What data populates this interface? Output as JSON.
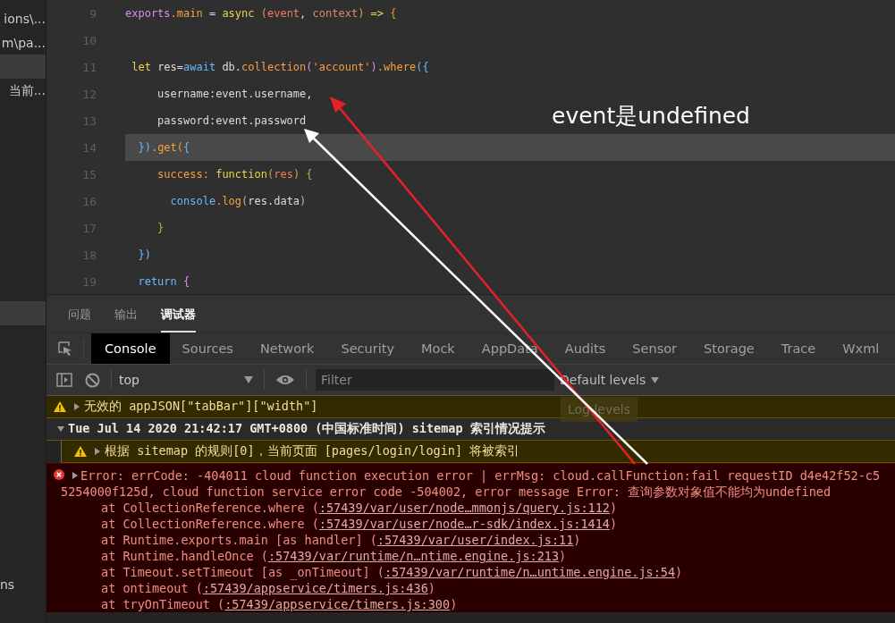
{
  "sidebar": {
    "upper": [
      {
        "label": "ions\\...",
        "selected": false
      },
      {
        "label": "m\\pa...",
        "selected": false
      },
      {
        "selected": true
      },
      {
        "label": "当前...",
        "selected": false
      }
    ],
    "lower": [
      {
        "selected": true
      }
    ],
    "footer": [
      {
        "label": "ns",
        "selected": false
      }
    ]
  },
  "editor": {
    "lines": [
      {
        "number": "9",
        "current": false,
        "tokens": [
          {
            "t": "exports",
            "kind": "module"
          },
          {
            "t": ".main",
            "kind": "prop"
          },
          {
            "t": " = ",
            "kind": "plain"
          },
          {
            "t": "async",
            "kind": "keyword"
          },
          {
            "t": " (",
            "kind": "paren"
          },
          {
            "t": "event",
            "kind": "param"
          },
          {
            "t": ", ",
            "kind": "plain"
          },
          {
            "t": "context",
            "kind": "param2"
          },
          {
            "t": ")",
            "kind": "paren"
          },
          {
            "t": " => ",
            "kind": "keyword"
          },
          {
            "t": "{",
            "kind": "paren"
          }
        ]
      },
      {
        "number": "10",
        "current": false
      },
      {
        "number": "11",
        "current": false,
        "tokens": [
          {
            "t": " let",
            "kind": "keyword"
          },
          {
            "t": " res=",
            "kind": "plain"
          },
          {
            "t": "await",
            "kind": "blue"
          },
          {
            "t": " db.",
            "kind": "plain"
          },
          {
            "t": "collection",
            "kind": "prop"
          },
          {
            "t": "(",
            "kind": "module"
          },
          {
            "t": "'account'",
            "kind": "prop"
          },
          {
            "t": ")",
            "kind": "module"
          },
          {
            "t": ".where",
            "kind": "prop"
          },
          {
            "t": "({",
            "kind": "blue"
          }
        ]
      },
      {
        "number": "12",
        "current": false,
        "tokens": [
          {
            "t": "     username:event.username,",
            "kind": "plain"
          }
        ]
      },
      {
        "number": "13",
        "current": false,
        "tokens": [
          {
            "t": "     password:event.password",
            "kind": "plain"
          }
        ]
      },
      {
        "number": "14",
        "current": true,
        "tokens": [
          {
            "t": "  })",
            "kind": "blue"
          },
          {
            "t": ".get",
            "kind": "prop"
          },
          {
            "t": "(",
            "kind": "paren"
          },
          {
            "t": "{",
            "kind": "blue"
          }
        ]
      },
      {
        "number": "15",
        "current": false,
        "tokens": [
          {
            "t": "     success: ",
            "kind": "prop"
          },
          {
            "t": "function",
            "kind": "keyword"
          },
          {
            "t": "(",
            "kind": "paren"
          },
          {
            "t": "res",
            "kind": "param"
          },
          {
            "t": ") ",
            "kind": "paren"
          },
          {
            "t": "{",
            "kind": "green"
          }
        ]
      },
      {
        "number": "16",
        "current": false,
        "tokens": [
          {
            "t": "       console",
            "kind": "blue"
          },
          {
            "t": ".log",
            "kind": "prop"
          },
          {
            "t": "(",
            "kind": "module"
          },
          {
            "t": "res.data",
            "kind": "plain"
          },
          {
            "t": ")",
            "kind": "module"
          }
        ]
      },
      {
        "number": "17",
        "current": false,
        "tokens": [
          {
            "t": "     }",
            "kind": "green"
          }
        ]
      },
      {
        "number": "18",
        "current": false,
        "tokens": [
          {
            "t": "  })",
            "kind": "blue"
          }
        ]
      },
      {
        "number": "19",
        "current": false,
        "tokens": [
          {
            "t": "  return ",
            "kind": "blue"
          },
          {
            "t": "{",
            "kind": "module"
          }
        ]
      }
    ]
  },
  "annotation": {
    "text": "event是undefined"
  },
  "panel_tabs": [
    {
      "label": "问题",
      "selected": false
    },
    {
      "label": "输出",
      "selected": false
    },
    {
      "label": "调试器",
      "selected": true
    }
  ],
  "devtools_tabs": [
    {
      "label": "Console",
      "selected": true
    },
    {
      "label": "Sources",
      "selected": false
    },
    {
      "label": "Network",
      "selected": false
    },
    {
      "label": "Security",
      "selected": false
    },
    {
      "label": "Mock",
      "selected": false
    },
    {
      "label": "AppData",
      "selected": false
    },
    {
      "label": "Audits",
      "selected": false
    },
    {
      "label": "Sensor",
      "selected": false
    },
    {
      "label": "Storage",
      "selected": false
    },
    {
      "label": "Trace",
      "selected": false
    },
    {
      "label": "Wxml",
      "selected": false
    }
  ],
  "toolbar": {
    "context": "top",
    "filter": {
      "placeholder": "Filter"
    },
    "levels": "Default levels",
    "tooltip": "Log levels"
  },
  "console": [
    {
      "kind": "warning",
      "expanded": false,
      "text": "无效的 appJSON[\"tabBar\"][\"width\"]"
    },
    {
      "kind": "group",
      "expanded": true,
      "text": "Tue Jul 14 2020 21:42:17 GMT+0800 (中国标准时间) sitemap 索引情况提示",
      "children": [
        {
          "kind": "warning",
          "expanded": false,
          "text": "根据 sitemap 的规则[0]，当前页面 [pages/login/login] 将被索引"
        }
      ]
    },
    {
      "kind": "error",
      "expanded": false,
      "lines": [
        "Error: errCode: -404011 cloud function execution error | errMsg: cloud.callFunction:fail requestID d4e42f52-c5",
        "5254000f125d, cloud function service error code -504002, error message Error: 查询参数对象值不能均为undefined"
      ],
      "stack": [
        {
          "text": "at CollectionReference.where (",
          "link": ":57439/var/user/node…mmonjs/query.js:112",
          "end": ")"
        },
        {
          "text": "at CollectionReference.where (",
          "link": ":57439/var/user/node…r-sdk/index.js:1414",
          "end": ")"
        },
        {
          "text": "at Runtime.exports.main [as handler] (",
          "link": ":57439/var/user/index.js:11",
          "end": ")"
        },
        {
          "text": "at Runtime.handleOnce (",
          "link": ":57439/var/runtime/n…ntime.engine.js:213",
          "end": ")"
        },
        {
          "text": "at Timeout.setTimeout [as _onTimeout] (",
          "link": ":57439/var/runtime/n…untime.engine.js:54",
          "end": ")"
        },
        {
          "text": "at ontimeout (",
          "link": ":57439/appservice/timers.js:436",
          "end": ")"
        },
        {
          "text": "at tryOnTimeout (",
          "link": ":57439/appservice/timers.js:300",
          "end": ")"
        }
      ]
    }
  ]
}
